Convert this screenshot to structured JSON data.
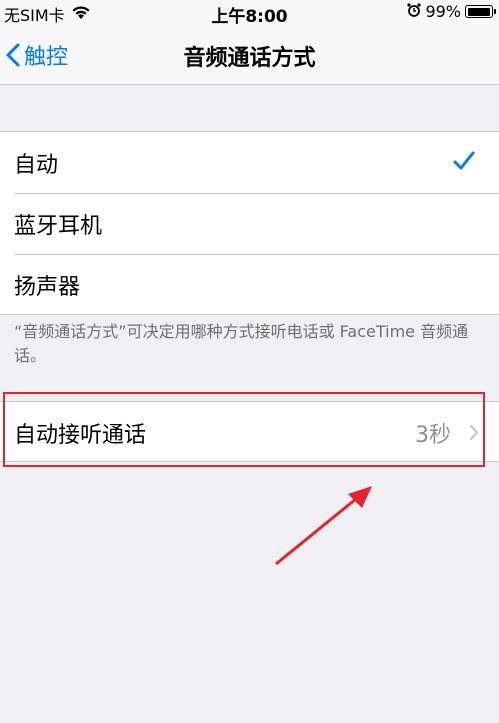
{
  "status_bar": {
    "carrier": "无SIM卡",
    "time": "上午8:00",
    "battery": "99%",
    "battery_level": 0.99
  },
  "nav": {
    "back_label": "触控",
    "title": "音频通话方式"
  },
  "route_options": [
    {
      "label": "自动",
      "selected": true
    },
    {
      "label": "蓝牙耳机",
      "selected": false
    },
    {
      "label": "扬声器",
      "selected": false
    }
  ],
  "footer_note": "“音频通话方式”可决定用哪种方式接听电话或 FaceTime 音频通话。",
  "auto_answer": {
    "label": "自动接听通话",
    "value": "3秒"
  },
  "colors": {
    "accent": "#007aff",
    "highlight": "#e5232e"
  },
  "icons": {
    "wifi": "wifi-icon",
    "alarm": "alarm-icon",
    "back": "chevron-left-icon",
    "check": "checkmark-icon",
    "disclosure": "chevron-right-icon"
  }
}
